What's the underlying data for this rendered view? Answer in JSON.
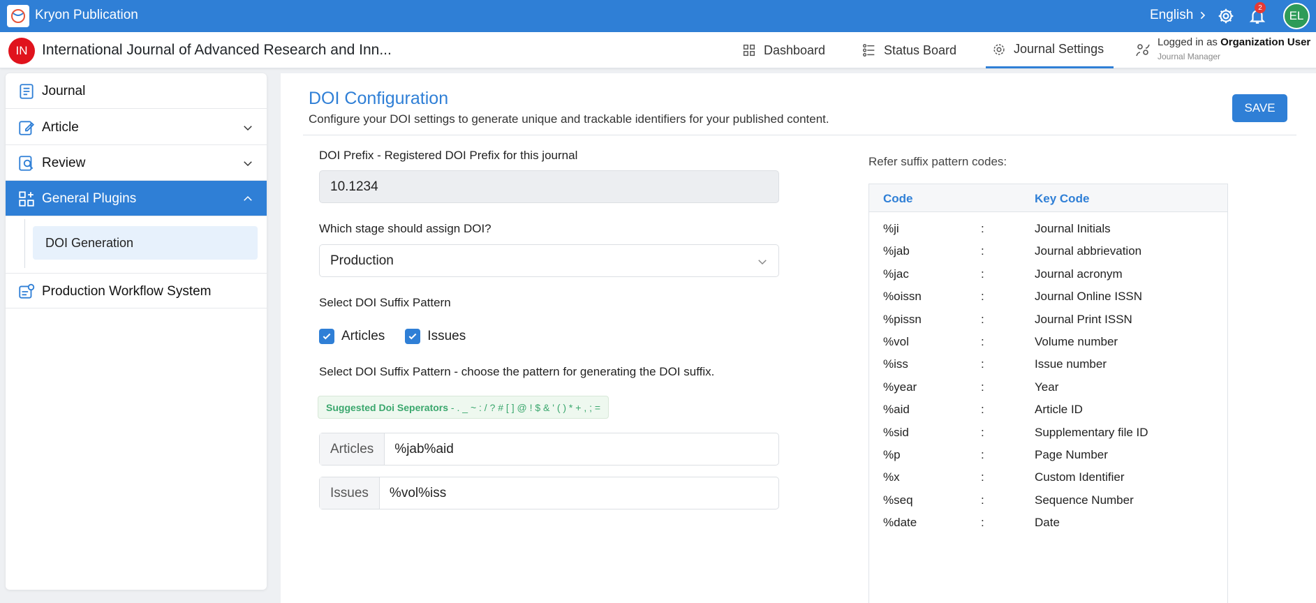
{
  "topbar": {
    "app_title": "Kryon Publication",
    "language": "English",
    "notification_count": "2",
    "user_initials": "EL"
  },
  "subbar": {
    "journal_initials": "IN",
    "journal_name": "International Journal of Advanced Research and Inn...",
    "nav": [
      {
        "label": "Dashboard",
        "icon": "dashboard-icon"
      },
      {
        "label": "Status Board",
        "icon": "status-board-icon"
      },
      {
        "label": "Journal Settings",
        "icon": "gear-icon",
        "active": true
      }
    ],
    "logged_in_prefix": "Logged in as",
    "logged_in_user": "Organization User",
    "role": "Journal Manager"
  },
  "sidebar": {
    "items": [
      {
        "label": "Journal"
      },
      {
        "label": "Article"
      },
      {
        "label": "Review"
      },
      {
        "label": "General Plugins",
        "active": true
      },
      {
        "label": "Production Workflow System"
      }
    ],
    "sub_item": "DOI Generation"
  },
  "main": {
    "title": "DOI Configuration",
    "subtitle": "Configure your DOI settings to generate unique and trackable identifiers for your published content.",
    "save_label": "SAVE",
    "prefix_label": "DOI Prefix - Registered DOI Prefix for this journal",
    "prefix_value": "10.1234",
    "stage_label": "Which stage should assign DOI?",
    "stage_value": "Production",
    "suffix_label": "Select DOI Suffix Pattern",
    "checkbox_articles": "Articles",
    "checkbox_issues": "Issues",
    "pattern_label": "Select DOI Suffix Pattern - choose the pattern for generating the DOI suffix.",
    "separators_title": "Suggested Doi Seperators",
    "separators_list": " - . _ ~ : / ? # [ ] @ ! $ & ' ( ) * + , ; =",
    "articles_addon": "Articles",
    "articles_value": "%jab%aid",
    "issues_addon": "Issues",
    "issues_value": "%vol%iss"
  },
  "codes": {
    "refer_label": "Refer suffix pattern codes:",
    "header_code": "Code",
    "header_key": "Key Code",
    "separator": ":",
    "rows": [
      {
        "code": "%ji",
        "key": "Journal Initials"
      },
      {
        "code": "%jab",
        "key": "Journal abbrievation"
      },
      {
        "code": "%jac",
        "key": "Journal acronym"
      },
      {
        "code": "%oissn",
        "key": "Journal Online ISSN"
      },
      {
        "code": "%pissn",
        "key": "Journal Print ISSN"
      },
      {
        "code": "%vol",
        "key": "Volume number"
      },
      {
        "code": "%iss",
        "key": "Issue number"
      },
      {
        "code": "%year",
        "key": "Year"
      },
      {
        "code": "%aid",
        "key": "Article ID"
      },
      {
        "code": "%sid",
        "key": "Supplementary file ID"
      },
      {
        "code": "%p",
        "key": "Page Number"
      },
      {
        "code": "%x",
        "key": "Custom Identifier"
      },
      {
        "code": "%seq",
        "key": "Sequence Number"
      },
      {
        "code": "%date",
        "key": "Date"
      }
    ]
  }
}
